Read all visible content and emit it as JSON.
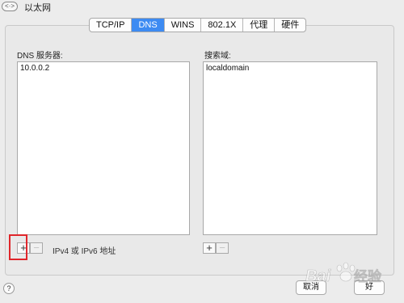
{
  "window": {
    "title": "以太网",
    "nav_icon": "<·>"
  },
  "tabs": [
    {
      "label": "TCP/IP",
      "active": false
    },
    {
      "label": "DNS",
      "active": true
    },
    {
      "label": "WINS",
      "active": false
    },
    {
      "label": "802.1X",
      "active": false
    },
    {
      "label": "代理",
      "active": false
    },
    {
      "label": "硬件",
      "active": false
    }
  ],
  "dns": {
    "label": "DNS 服务器:",
    "servers": [
      "10.0.0.2"
    ],
    "add_label": "+",
    "remove_label": "−",
    "hint": "IPv4 或 IPv6 地址"
  },
  "search": {
    "label": "搜索域:",
    "domains": [
      "localdomain"
    ],
    "add_label": "+",
    "remove_label": "−"
  },
  "footer": {
    "help_label": "?",
    "cancel_label": "取消",
    "ok_label": "好"
  },
  "colors": {
    "accent": "#3d8bf2",
    "highlight": "#e0262b"
  },
  "watermark": "Baidu 经验"
}
